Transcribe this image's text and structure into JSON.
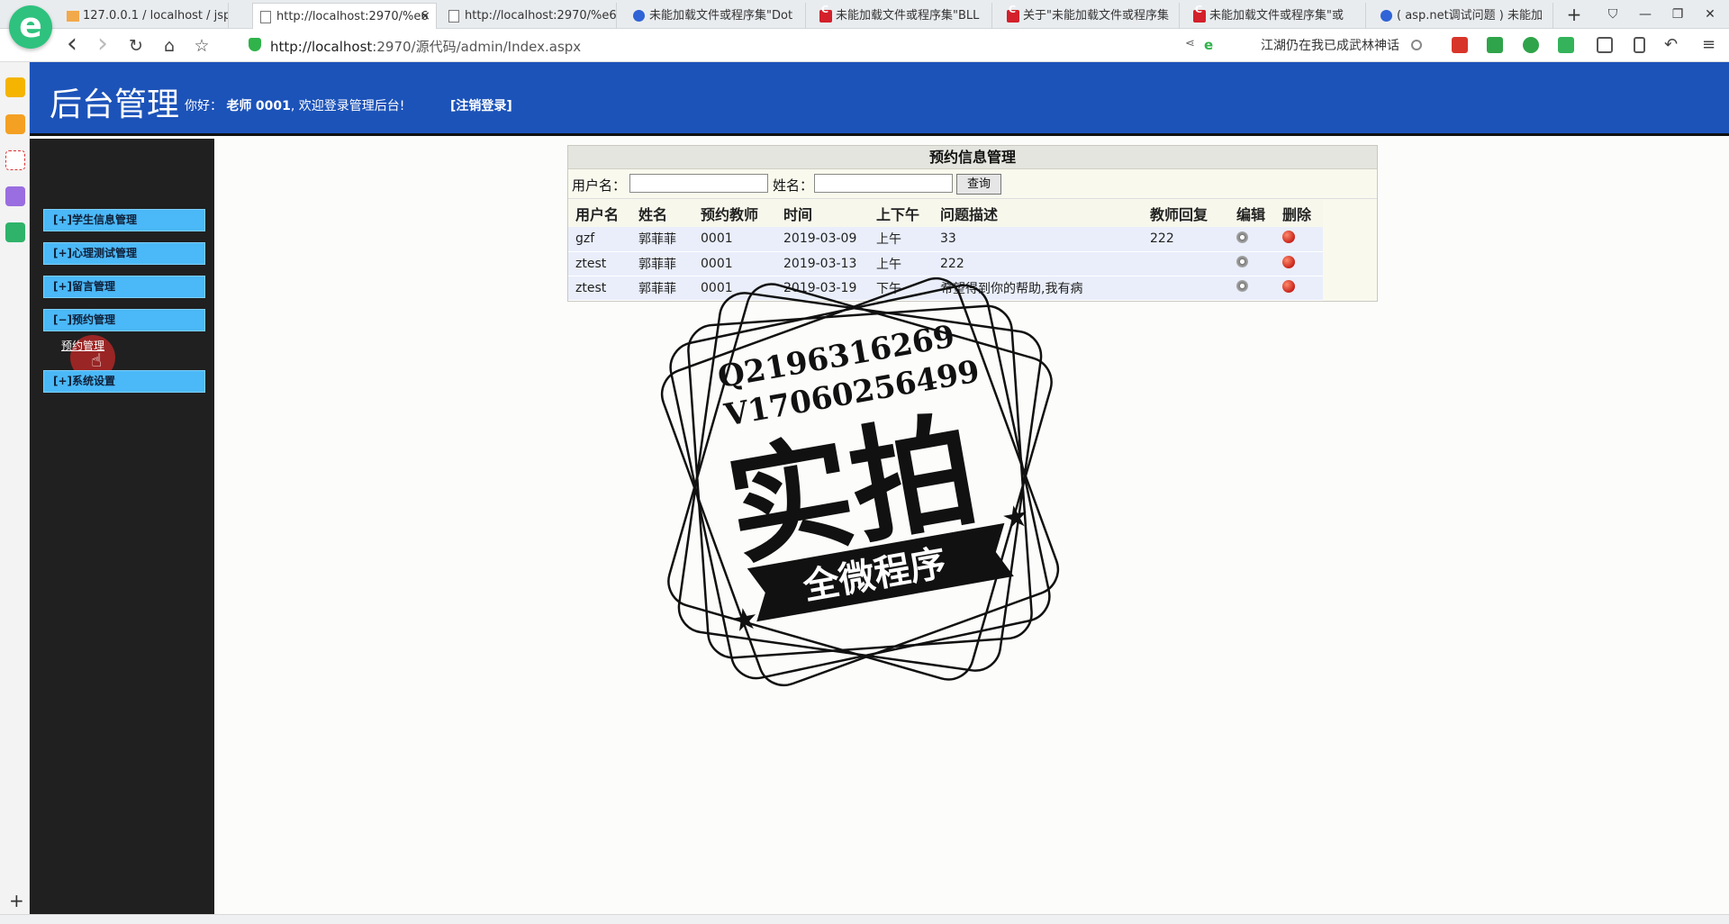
{
  "browser": {
    "logo_glyph": "e",
    "tabs": [
      {
        "title": "127.0.0.1 / localhost / jsp",
        "icon": "pma"
      },
      {
        "title": "http://localhost:2970/%e6",
        "icon": "page",
        "active": true,
        "close": "×"
      },
      {
        "title": "http://localhost:2970/%e6",
        "icon": "page"
      },
      {
        "title": "未能加载文件或程序集\"Dot",
        "icon": "paw"
      },
      {
        "title": "未能加载文件或程序集\"BLL",
        "icon": "red"
      },
      {
        "title": "关于\"未能加载文件或程序集",
        "icon": "red"
      },
      {
        "title": "未能加载文件或程序集\"或",
        "icon": "red"
      },
      {
        "title": "( asp.net调试问题 ) 未能加",
        "icon": "paw"
      }
    ],
    "new_tab": "+",
    "window_controls": [
      "⛉",
      "—",
      "❐",
      "✕"
    ],
    "nav": {
      "back": "‹",
      "forward": "›",
      "refresh": "↻",
      "home": "⌂",
      "favorite": "☆"
    },
    "url": {
      "host": "http://localhost",
      "rest": ":2970/源代码/admin/Index.aspx"
    },
    "search_hint": "江湖仍在我已成武林神话",
    "share_icon": "share-icon",
    "ie_icon": "ie-mode-icon"
  },
  "page": {
    "site_title": "后台管理",
    "greeting_prefix": "你好：",
    "user_role": "老师",
    "user_id": "0001",
    "greeting_suffix": ", 欢迎登录管理后台!",
    "logout": "[注销登录]",
    "sidebar": {
      "menus": [
        {
          "label": "[+]学生信息管理"
        },
        {
          "label": "[+]心理测试管理"
        },
        {
          "label": "[+]留言管理"
        },
        {
          "label": "[−]预约管理"
        },
        {
          "label": "[+]系统设置"
        }
      ],
      "sub_item": "预约管理"
    },
    "panel": {
      "title": "预约信息管理",
      "search": {
        "username_label": "用户名：",
        "name_label": "姓名：",
        "username_value": "",
        "name_value": "",
        "button": "查询"
      },
      "columns": [
        "用户名",
        "姓名",
        "预约教师",
        "时间",
        "上下午",
        "问题描述",
        "教师回复",
        "编辑",
        "删除"
      ],
      "rows": [
        {
          "username": "gzf",
          "name": "郭菲菲",
          "teacher": "0001",
          "date": "2019-03-09",
          "period": "上午",
          "desc": "33",
          "reply": "222"
        },
        {
          "username": "ztest",
          "name": "郭菲菲",
          "teacher": "0001",
          "date": "2019-03-13",
          "period": "上午",
          "desc": "222",
          "reply": ""
        },
        {
          "username": "ztest",
          "name": "郭菲菲",
          "teacher": "0001",
          "date": "2019-03-19",
          "period": "下午",
          "desc": "希望得到你的帮助,我有病",
          "reply": ""
        }
      ]
    },
    "watermark": {
      "line1": "Q2196316269",
      "line2": "V17060256499",
      "big": "实拍",
      "banner": "全微程序"
    }
  },
  "colors": {
    "header": "#1c53b9",
    "sidebar": "#202020",
    "menu": "#4bb8f7",
    "row": "#e9eefa"
  }
}
